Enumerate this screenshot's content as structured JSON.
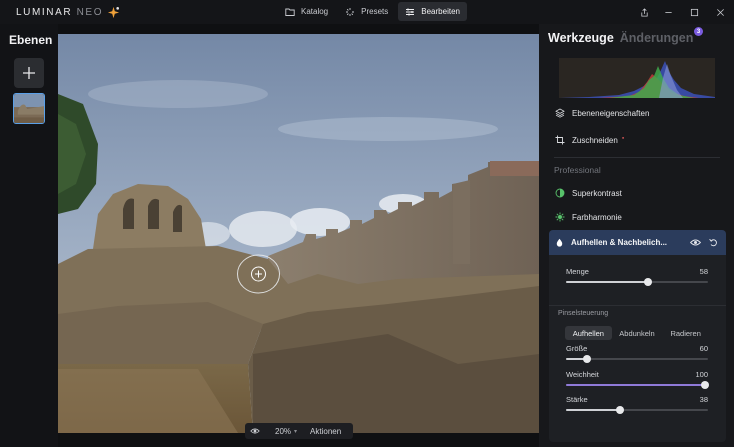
{
  "app": {
    "logo_main": "LUMINAR",
    "logo_sub": "NEO"
  },
  "nav": [
    {
      "label": "Katalog",
      "icon": "folder-icon",
      "active": false
    },
    {
      "label": "Presets",
      "icon": "presets-icon",
      "active": false
    },
    {
      "label": "Bearbeiten",
      "icon": "sliders-icon",
      "active": true
    }
  ],
  "left_panel": {
    "title": "Ebenen"
  },
  "canvas": {
    "zoom": "20%",
    "actions_label": "Aktionen"
  },
  "right_panel": {
    "tab_tools": "Werkzeuge",
    "tab_changes": "Änderungen",
    "changes_count": "3",
    "items": [
      {
        "label": "Ebeneneigenschaften",
        "icon": "layers-icon"
      },
      {
        "label": "Zuschneiden",
        "icon": "crop-icon"
      }
    ],
    "section_professional": "Professional",
    "pro_tools": [
      {
        "label": "Superkontrast",
        "icon": "contrast-icon",
        "color": "#58c26b"
      },
      {
        "label": "Farbharmonie",
        "icon": "gear-color-icon",
        "color": "#58c26b"
      }
    ],
    "open_tool": {
      "title": "Aufhellen & Nachbelich...",
      "amount_label": "Menge",
      "amount_value": "58",
      "brush_section": "Pinselsteuerung",
      "modes": [
        "Aufhellen",
        "Abdunkeln",
        "Radieren"
      ],
      "size_label": "Größe",
      "size_value": "60",
      "softness_label": "Weichheit",
      "softness_value": "100",
      "strength_label": "Stärke",
      "strength_value": "38"
    }
  }
}
